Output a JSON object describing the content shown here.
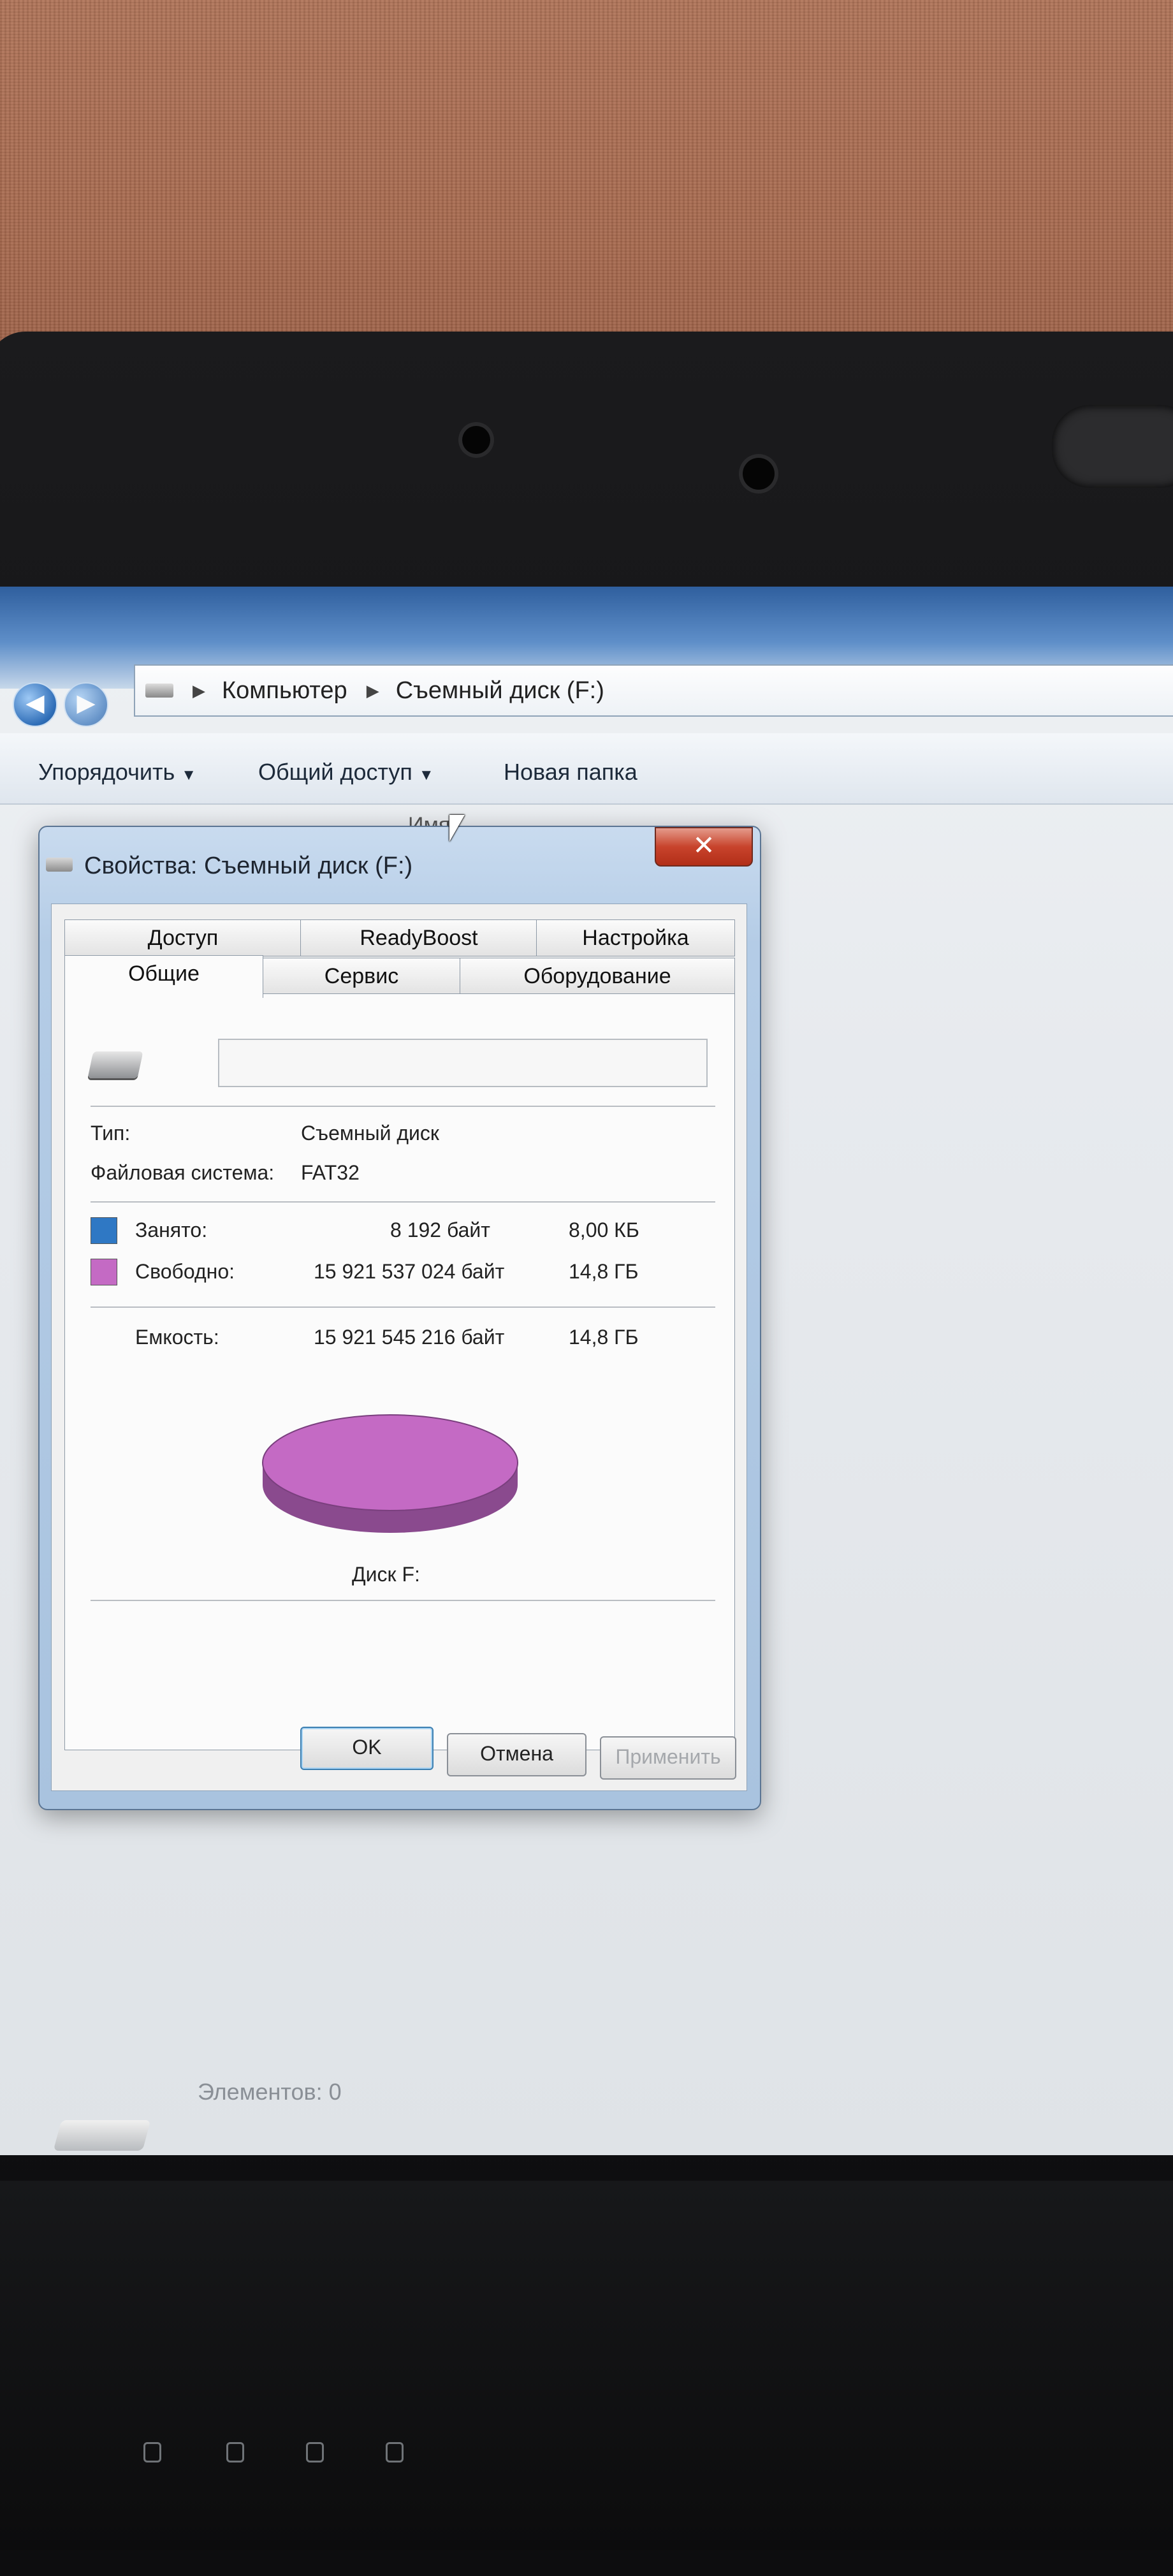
{
  "explorer": {
    "address_segments": [
      "Компьютер",
      "Съемный диск (F:)"
    ],
    "toolbar": {
      "organize": "Упорядочить",
      "share": "Общий доступ",
      "new_folder": "Новая папка"
    },
    "column_name": "Имя",
    "status_items": "Элементов: 0"
  },
  "dialog": {
    "title": "Свойства: Съемный диск (F:)",
    "close_glyph": "✕",
    "tabs_top": [
      "Доступ",
      "ReadyBoost",
      "Настройка"
    ],
    "tabs_bottom": [
      "Общие",
      "Сервис",
      "Оборудование"
    ],
    "active_tab": "Общие",
    "volume_label_value": "",
    "type_label": "Тип:",
    "type_value": "Съемный диск",
    "fs_label": "Файловая система:",
    "fs_value": "FAT32",
    "used_label": "Занято:",
    "used_bytes": "8 192 байт",
    "used_size": "8,00 КБ",
    "free_label": "Свободно:",
    "free_bytes": "15 921 537 024 байт",
    "free_size": "14,8 ГБ",
    "capacity_label": "Емкость:",
    "capacity_bytes": "15 921 545 216 байт",
    "capacity_size": "14,8 ГБ",
    "disk_label": "Диск F:",
    "used_color": "#2f78c4",
    "free_color": "#c46ac4",
    "used_fraction": 5e-07,
    "buttons": {
      "ok": "OK",
      "cancel": "Отмена",
      "apply": "Применить"
    }
  }
}
